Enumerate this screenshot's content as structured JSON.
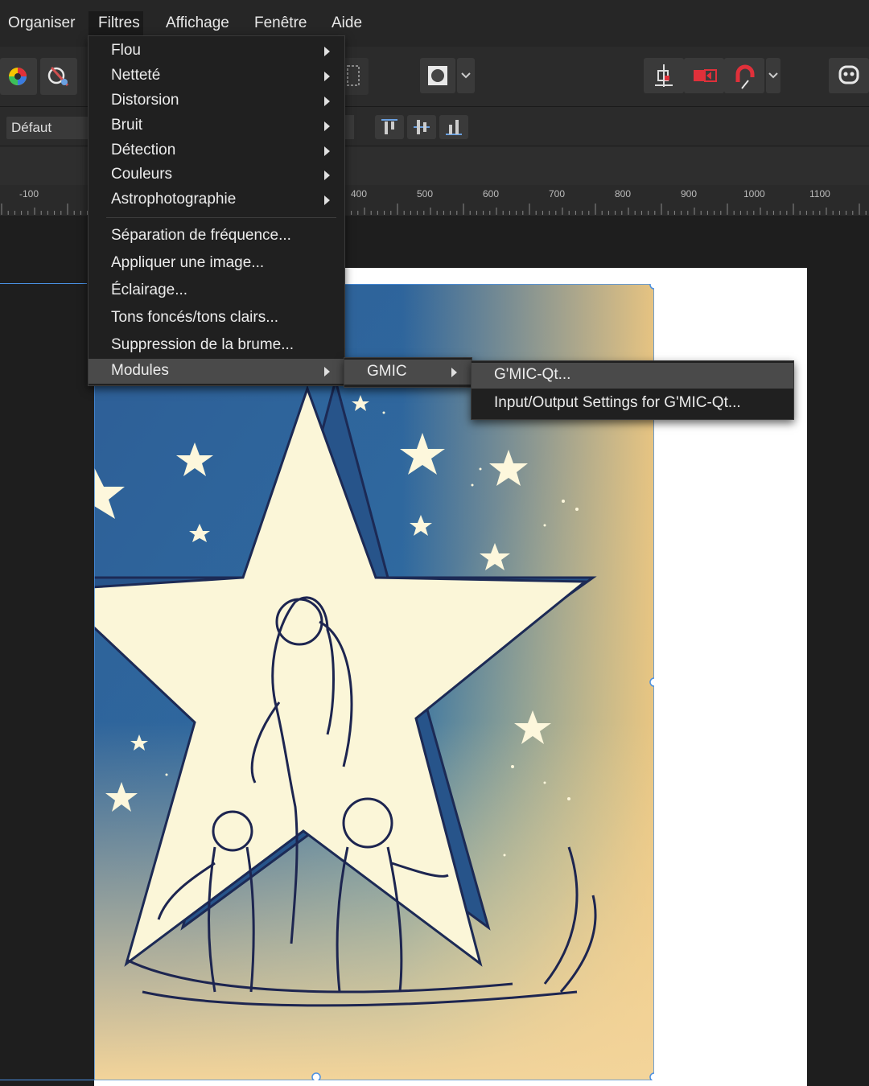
{
  "menubar": {
    "items": [
      "Organiser",
      "Filtres",
      "Affichage",
      "Fenêtre",
      "Aide"
    ]
  },
  "toolbar": {
    "icons": [
      "color-wheel-icon",
      "brush-adjust-icon",
      "marquee-icon",
      "mask-icon",
      "chevron-down-icon",
      "snapping-icon",
      "red-toggle-icon",
      "magnet-icon",
      "chevron-down-icon",
      "assistant-icon"
    ]
  },
  "context": {
    "preset": "Défaut"
  },
  "ruler": {
    "labels": [
      "-100",
      "400",
      "500",
      "600",
      "700",
      "800",
      "900",
      "1000",
      "1100"
    ]
  },
  "filters_menu": {
    "group1": [
      {
        "label": "Flou",
        "submenu": true
      },
      {
        "label": "Netteté",
        "submenu": true
      },
      {
        "label": "Distorsion",
        "submenu": true
      },
      {
        "label": "Bruit",
        "submenu": true
      },
      {
        "label": "Détection",
        "submenu": true
      },
      {
        "label": "Couleurs",
        "submenu": true
      },
      {
        "label": "Astrophotographie",
        "submenu": true
      }
    ],
    "group2": [
      {
        "label": "Séparation de fréquence..."
      },
      {
        "label": "Appliquer une image..."
      },
      {
        "label": "Éclairage..."
      },
      {
        "label": "Tons foncés/tons clairs..."
      },
      {
        "label": "Suppression de la brume..."
      }
    ],
    "modules": {
      "label": "Modules",
      "submenu": true
    }
  },
  "modules_menu": {
    "items": [
      {
        "label": "GMIC",
        "submenu": true
      }
    ]
  },
  "gmic_menu": {
    "items": [
      {
        "label": "G'MIC-Qt..."
      },
      {
        "label": "Input/Output Settings for G'MIC-Qt..."
      }
    ]
  },
  "colors": {
    "accent": "#4a90e2",
    "menu_bg": "#202020",
    "highlight": "#4a4a4a",
    "red": "#e0303a"
  }
}
